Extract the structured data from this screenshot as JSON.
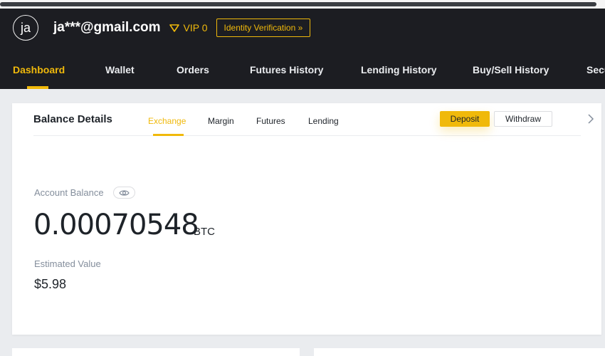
{
  "header": {
    "avatar_initials": "ja",
    "email": "ja***@gmail.com",
    "vip_label": "VIP 0",
    "identity_verification": "Identity Verification »",
    "accent_color": "#f0b90b",
    "background_color": "#1c1d22"
  },
  "nav": {
    "items": [
      {
        "label": "Dashboard",
        "active": true
      },
      {
        "label": "Wallet"
      },
      {
        "label": "Orders"
      },
      {
        "label": "Futures History"
      },
      {
        "label": "Lending History"
      },
      {
        "label": "Buy/Sell History"
      },
      {
        "label": "Secu"
      }
    ]
  },
  "balance": {
    "title": "Balance Details",
    "tabs": [
      {
        "label": "Exchange",
        "active": true
      },
      {
        "label": "Margin"
      },
      {
        "label": "Futures"
      },
      {
        "label": "Lending"
      }
    ],
    "deposit_label": "Deposit",
    "withdraw_label": "Withdraw",
    "account_balance_label": "Account Balance",
    "btc_amount": "0.00070548",
    "btc_unit": "BTC",
    "estimated_value_label": "Estimated Value",
    "estimated_value": "$5.98"
  },
  "icons": {
    "vip": "diamond-icon",
    "visibility": "eye-icon",
    "next": "chevron-right-icon"
  }
}
